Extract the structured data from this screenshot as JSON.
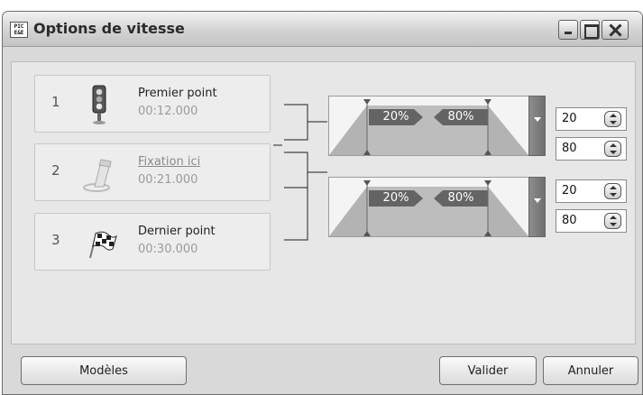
{
  "window": {
    "title": "Options de vitesse",
    "app_icon_text": "PIC\nE&E"
  },
  "points": [
    {
      "number": "1",
      "name": "Premier point",
      "time": "00:12.000",
      "icon": "traffic-light-icon"
    },
    {
      "number": "2",
      "name": "Fixation ici",
      "time": "00:21.000",
      "icon": "pin-icon"
    },
    {
      "number": "3",
      "name": "Dernier point",
      "time": "00:30.000",
      "icon": "checkered-flag-icon"
    }
  ],
  "speed_curves": [
    {
      "ease_in_label": "20%",
      "ease_out_label": "80%",
      "ease_in_value": "20",
      "ease_out_value": "80"
    },
    {
      "ease_in_label": "20%",
      "ease_out_label": "80%",
      "ease_in_value": "20",
      "ease_out_value": "80"
    }
  ],
  "buttons": {
    "models": "Modèles",
    "ok": "Valider",
    "cancel": "Annuler"
  }
}
